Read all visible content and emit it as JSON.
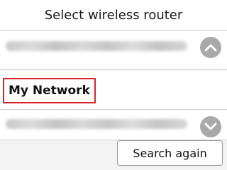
{
  "header": {
    "title": "Select wireless router"
  },
  "router_list": {
    "items": [
      {
        "label": "",
        "obscured": true
      },
      {
        "label": "My Network",
        "selected": true,
        "highlight_color": "#d4232a"
      },
      {
        "label": "",
        "obscured": true
      }
    ]
  },
  "actions": {
    "search_again_label": "Search again"
  },
  "icons": {
    "scroll_up": "chevron-up-icon",
    "scroll_down": "chevron-down-icon"
  },
  "colors": {
    "selection_border": "#d4232a",
    "scroll_button": "#a9a9a9"
  }
}
